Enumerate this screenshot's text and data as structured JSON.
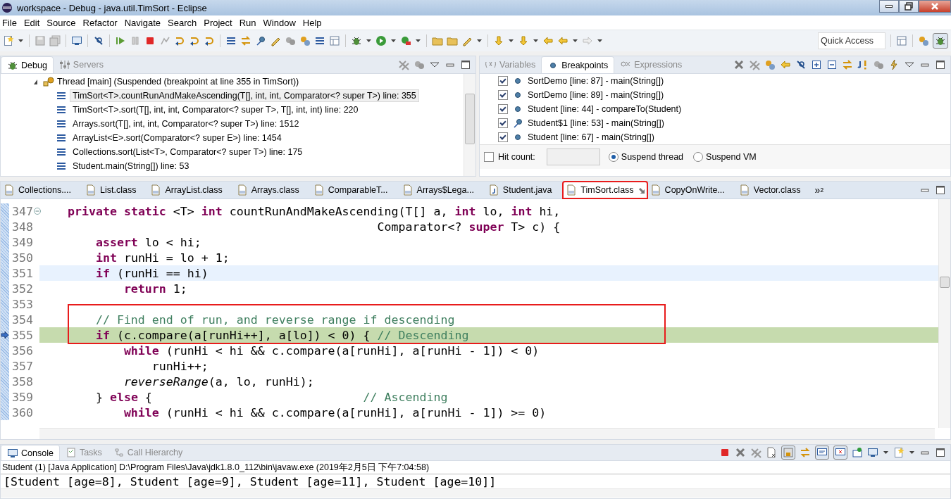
{
  "window": {
    "title": "workspace - Debug - java.util.TimSort - Eclipse"
  },
  "menu": [
    "File",
    "Edit",
    "Source",
    "Refactor",
    "Navigate",
    "Search",
    "Project",
    "Run",
    "Window",
    "Help"
  ],
  "toolbar": {
    "quick_access": {
      "placeholder": "Quick Access"
    }
  },
  "debug_view": {
    "tabs": [
      {
        "label": "Debug",
        "selected": true
      },
      {
        "label": "Servers",
        "selected": false
      }
    ],
    "threads": [
      {
        "label": "Thread [main] (Suspended (breakpoint at line 355 in TimSort))",
        "expanded": true,
        "children": [
          {
            "label": "TimSort<T>.countRunAndMakeAscending(T[], int, int, Comparator<? super T>) line: 355",
            "selected": true
          },
          {
            "label": "TimSort<T>.sort(T[], int, int, Comparator<? super T>, T[], int, int) line: 220",
            "selected": false
          },
          {
            "label": "Arrays.sort(T[], int, int, Comparator<? super T>) line: 1512",
            "selected": false
          },
          {
            "label": "ArrayList<E>.sort(Comparator<? super E>) line: 1454",
            "selected": false
          },
          {
            "label": "Collections.sort(List<T>, Comparator<? super T>) line: 175",
            "selected": false
          },
          {
            "label": "Student.main(String[]) line: 53",
            "selected": false
          }
        ]
      }
    ]
  },
  "breakpoints_view": {
    "tabs": [
      {
        "label": "Variables",
        "selected": false
      },
      {
        "label": "Breakpoints",
        "selected": true
      },
      {
        "label": "Expressions",
        "selected": false
      }
    ],
    "breakpoints": [
      {
        "label": "SortDemo [line: 87] - main(String[])",
        "checked": true,
        "kind": "line"
      },
      {
        "label": "SortDemo [line: 89] - main(String[])",
        "checked": true,
        "kind": "line"
      },
      {
        "label": "Student [line: 44] - compareTo(Student)",
        "checked": true,
        "kind": "line"
      },
      {
        "label": "Student$1 [line: 53] - main(String[])",
        "checked": true,
        "kind": "trigger"
      },
      {
        "label": "Student [line: 67] - main(String[])",
        "checked": true,
        "kind": "line"
      }
    ],
    "hit_count": {
      "label": "Hit count:",
      "checked": false
    },
    "suspend_options": [
      {
        "label": "Suspend thread",
        "selected": true
      },
      {
        "label": "Suspend VM",
        "selected": false
      }
    ]
  },
  "editor": {
    "tabs": [
      {
        "label": "Collections....",
        "kind": "class",
        "selected": false,
        "annotated": false
      },
      {
        "label": "List.class",
        "kind": "class",
        "selected": false,
        "annotated": false
      },
      {
        "label": "ArrayList.class",
        "kind": "class",
        "selected": false,
        "annotated": false
      },
      {
        "label": "Arrays.class",
        "kind": "class",
        "selected": false,
        "annotated": false
      },
      {
        "label": "ComparableT...",
        "kind": "class",
        "selected": false,
        "annotated": false
      },
      {
        "label": "Arrays$Lega...",
        "kind": "class",
        "selected": false,
        "annotated": false
      },
      {
        "label": "Student.java",
        "kind": "java",
        "selected": false,
        "annotated": false
      },
      {
        "label": "TimSort.class",
        "kind": "class",
        "selected": true,
        "annotated": true
      },
      {
        "label": "CopyOnWrite...",
        "kind": "class",
        "selected": false,
        "annotated": false
      },
      {
        "label": "Vector.class",
        "kind": "class",
        "selected": false,
        "annotated": false
      }
    ],
    "overflow": {
      "icon": "»",
      "count": "2"
    },
    "lines": [
      {
        "number": "347",
        "current": false,
        "execution": false,
        "boxed": false,
        "foldable": true,
        "segments": [
          {
            "kind": "keyword",
            "text": "    private"
          },
          {
            "kind": "keyword",
            "text": " static"
          },
          {
            "kind": "plain",
            "text": " <T> "
          },
          {
            "kind": "keyword",
            "text": "int"
          },
          {
            "kind": "plain",
            "text": " countRunAndMakeAscending(T[] a, "
          },
          {
            "kind": "keyword",
            "text": "int"
          },
          {
            "kind": "plain",
            "text": " lo, "
          },
          {
            "kind": "keyword",
            "text": "int"
          },
          {
            "kind": "plain",
            "text": " hi,"
          }
        ]
      },
      {
        "number": "348",
        "current": false,
        "execution": false,
        "boxed": false,
        "foldable": false,
        "segments": [
          {
            "kind": "plain",
            "text": "                                                Comparator<? "
          },
          {
            "kind": "keyword",
            "text": "super"
          },
          {
            "kind": "plain",
            "text": " T> c) {"
          }
        ]
      },
      {
        "number": "349",
        "current": false,
        "execution": false,
        "boxed": false,
        "foldable": false,
        "segments": [
          {
            "kind": "keyword",
            "text": "        assert"
          },
          {
            "kind": "plain",
            "text": " lo < hi;"
          }
        ]
      },
      {
        "number": "350",
        "current": false,
        "execution": false,
        "boxed": false,
        "foldable": false,
        "segments": [
          {
            "kind": "keyword",
            "text": "        int"
          },
          {
            "kind": "plain",
            "text": " runHi = lo + 1;"
          }
        ]
      },
      {
        "number": "351",
        "current": true,
        "execution": false,
        "boxed": false,
        "foldable": false,
        "segments": [
          {
            "kind": "keyword",
            "text": "        if"
          },
          {
            "kind": "plain",
            "text": " (runHi == hi)"
          }
        ]
      },
      {
        "number": "352",
        "current": false,
        "execution": false,
        "boxed": false,
        "foldable": false,
        "segments": [
          {
            "kind": "keyword",
            "text": "            return"
          },
          {
            "kind": "plain",
            "text": " 1;"
          }
        ]
      },
      {
        "number": "353",
        "current": false,
        "execution": false,
        "boxed": false,
        "foldable": false
      },
      {
        "number": "354",
        "current": false,
        "execution": false,
        "boxed": true,
        "foldable": false,
        "segments": [
          {
            "kind": "comment",
            "text": "        // Find end of run, and reverse range if descending"
          }
        ]
      },
      {
        "number": "355",
        "current": false,
        "execution": true,
        "boxed": true,
        "foldable": false,
        "segments": [
          {
            "kind": "keyword",
            "text": "        if"
          },
          {
            "kind": "plain",
            "text": " (c.compare(a[runHi++], a[lo]) < 0) { "
          },
          {
            "kind": "comment",
            "text": "// Descending"
          }
        ]
      },
      {
        "number": "356",
        "current": false,
        "execution": false,
        "boxed": false,
        "foldable": false,
        "segments": [
          {
            "kind": "keyword",
            "text": "            while"
          },
          {
            "kind": "plain",
            "text": " (runHi < hi && c.compare(a[runHi], a[runHi - 1]) < 0)"
          }
        ]
      },
      {
        "number": "357",
        "current": false,
        "execution": false,
        "boxed": false,
        "foldable": false,
        "segments": [
          {
            "kind": "plain",
            "text": "                runHi++;"
          }
        ]
      },
      {
        "number": "358",
        "current": false,
        "execution": false,
        "boxed": false,
        "foldable": false,
        "segments": [
          {
            "kind": "method",
            "text": "            reverseRange"
          },
          {
            "kind": "plain",
            "text": "(a, lo, runHi);"
          }
        ]
      },
      {
        "number": "359",
        "current": false,
        "execution": false,
        "boxed": false,
        "foldable": false,
        "segments": [
          {
            "kind": "plain",
            "text": "        } "
          },
          {
            "kind": "keyword",
            "text": "else"
          },
          {
            "kind": "plain",
            "text": " {                              "
          },
          {
            "kind": "comment",
            "text": "// Ascending"
          }
        ]
      },
      {
        "number": "360",
        "current": false,
        "execution": false,
        "boxed": false,
        "foldable": false,
        "segments": [
          {
            "kind": "keyword",
            "text": "            while"
          },
          {
            "kind": "plain",
            "text": " (runHi < hi && c.compare(a[runHi], a[runHi - 1]) >= 0)"
          }
        ]
      }
    ]
  },
  "console": {
    "tabs": [
      {
        "label": "Console",
        "selected": true
      },
      {
        "label": "Tasks",
        "selected": false
      },
      {
        "label": "Call Hierarchy",
        "selected": false
      }
    ],
    "launch": "Student (1) [Java Application] D:\\Program Files\\Java\\jdk1.8.0_112\\bin\\javaw.exe (2019年2月5日 下午7:04:58)",
    "output": "[Student [age=8], Student [age=9], Student [age=11], Student [age=10]]"
  }
}
